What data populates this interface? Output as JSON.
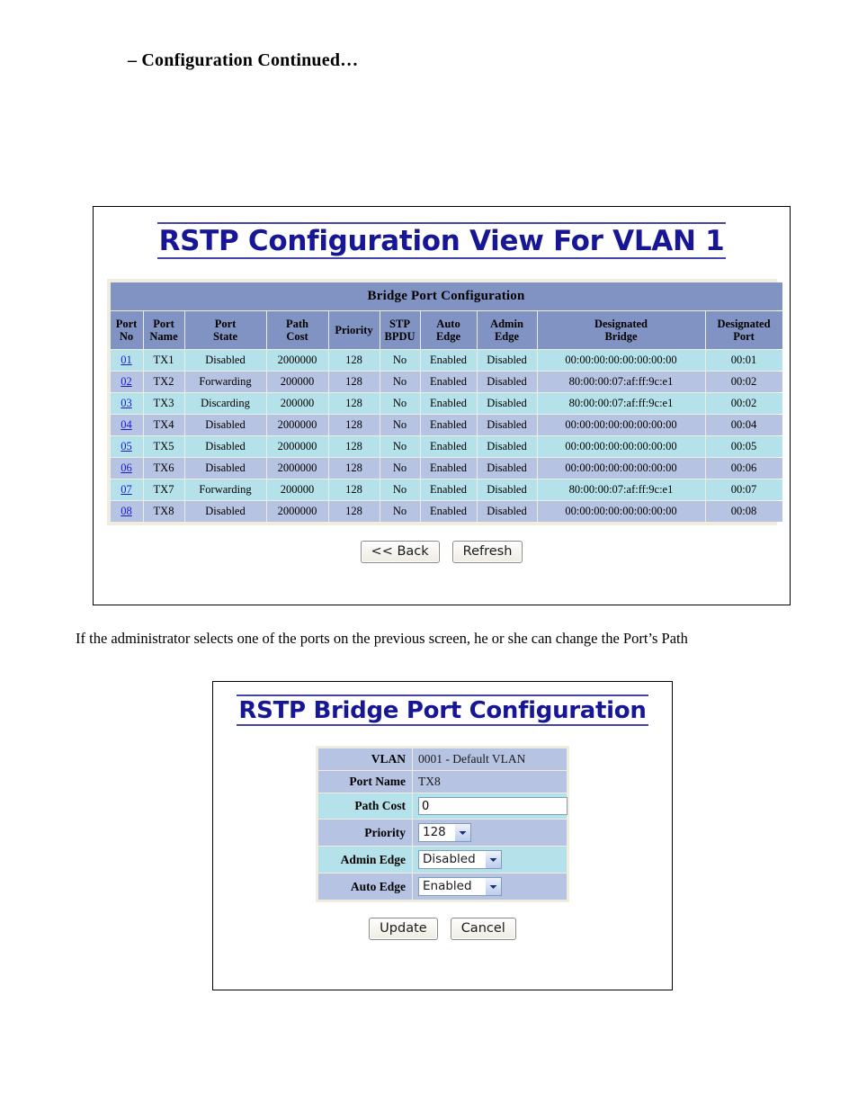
{
  "document": {
    "heading": "– Configuration Continued…",
    "paragraph": "If the administrator selects one of the ports on the previous screen, he or she can change the Port’s Path"
  },
  "colors": {
    "header_blue": "#8193c3",
    "row_odd": "#b5e2ea",
    "row_even": "#b6c3e2",
    "title_blue": "#171796",
    "link_blue": "#1b1bc8",
    "table_frame": "#efeddf"
  },
  "rstp_view": {
    "title": "RSTP Configuration View For VLAN 1",
    "table_caption": "Bridge Port Configuration",
    "columns": [
      "Port No",
      "Port Name",
      "Port State",
      "Path Cost",
      "Priority",
      "STP BPDU",
      "Auto Edge",
      "Admin Edge",
      "Designated Bridge",
      "Designated Port"
    ],
    "columns_split": [
      [
        "Port",
        "No"
      ],
      [
        "Port",
        "Name"
      ],
      [
        "Port",
        "State"
      ],
      [
        "Path",
        "Cost"
      ],
      [
        "Priority",
        ""
      ],
      [
        "STP",
        "BPDU"
      ],
      [
        "Auto",
        "Edge"
      ],
      [
        "Admin",
        "Edge"
      ],
      [
        "Designated",
        "Bridge"
      ],
      [
        "Designated",
        "Port"
      ]
    ],
    "rows": [
      {
        "port_no": "01",
        "port_name": "TX1",
        "port_state": "Disabled",
        "path_cost": "2000000",
        "priority": "128",
        "stp_bpdu": "No",
        "auto_edge": "Enabled",
        "admin_edge": "Disabled",
        "designated_bridge": "00:00:00:00:00:00:00:00",
        "designated_port": "00:01"
      },
      {
        "port_no": "02",
        "port_name": "TX2",
        "port_state": "Forwarding",
        "path_cost": "200000",
        "priority": "128",
        "stp_bpdu": "No",
        "auto_edge": "Enabled",
        "admin_edge": "Disabled",
        "designated_bridge": "80:00:00:07:af:ff:9c:e1",
        "designated_port": "00:02"
      },
      {
        "port_no": "03",
        "port_name": "TX3",
        "port_state": "Discarding",
        "path_cost": "200000",
        "priority": "128",
        "stp_bpdu": "No",
        "auto_edge": "Enabled",
        "admin_edge": "Disabled",
        "designated_bridge": "80:00:00:07:af:ff:9c:e1",
        "designated_port": "00:02"
      },
      {
        "port_no": "04",
        "port_name": "TX4",
        "port_state": "Disabled",
        "path_cost": "2000000",
        "priority": "128",
        "stp_bpdu": "No",
        "auto_edge": "Enabled",
        "admin_edge": "Disabled",
        "designated_bridge": "00:00:00:00:00:00:00:00",
        "designated_port": "00:04"
      },
      {
        "port_no": "05",
        "port_name": "TX5",
        "port_state": "Disabled",
        "path_cost": "2000000",
        "priority": "128",
        "stp_bpdu": "No",
        "auto_edge": "Enabled",
        "admin_edge": "Disabled",
        "designated_bridge": "00:00:00:00:00:00:00:00",
        "designated_port": "00:05"
      },
      {
        "port_no": "06",
        "port_name": "TX6",
        "port_state": "Disabled",
        "path_cost": "2000000",
        "priority": "128",
        "stp_bpdu": "No",
        "auto_edge": "Enabled",
        "admin_edge": "Disabled",
        "designated_bridge": "00:00:00:00:00:00:00:00",
        "designated_port": "00:06"
      },
      {
        "port_no": "07",
        "port_name": "TX7",
        "port_state": "Forwarding",
        "path_cost": "200000",
        "priority": "128",
        "stp_bpdu": "No",
        "auto_edge": "Enabled",
        "admin_edge": "Disabled",
        "designated_bridge": "80:00:00:07:af:ff:9c:e1",
        "designated_port": "00:07"
      },
      {
        "port_no": "08",
        "port_name": "TX8",
        "port_state": "Disabled",
        "path_cost": "2000000",
        "priority": "128",
        "stp_bpdu": "No",
        "auto_edge": "Enabled",
        "admin_edge": "Disabled",
        "designated_bridge": "00:00:00:00:00:00:00:00",
        "designated_port": "00:08"
      }
    ],
    "buttons": {
      "back": "<< Back",
      "refresh": "Refresh"
    }
  },
  "bridge_port_config": {
    "title": "RSTP Bridge Port Configuration",
    "fields": {
      "vlan": {
        "label": "VLAN",
        "value": "0001 - Default VLAN"
      },
      "port_name": {
        "label": "Port Name",
        "value": "TX8"
      },
      "path_cost": {
        "label": "Path Cost",
        "value": "0",
        "placeholder": ""
      },
      "priority": {
        "label": "Priority",
        "value": "128"
      },
      "admin_edge": {
        "label": "Admin Edge",
        "value": "Disabled"
      },
      "auto_edge": {
        "label": "Auto Edge",
        "value": "Enabled"
      }
    },
    "buttons": {
      "update": "Update",
      "cancel": "Cancel"
    }
  }
}
